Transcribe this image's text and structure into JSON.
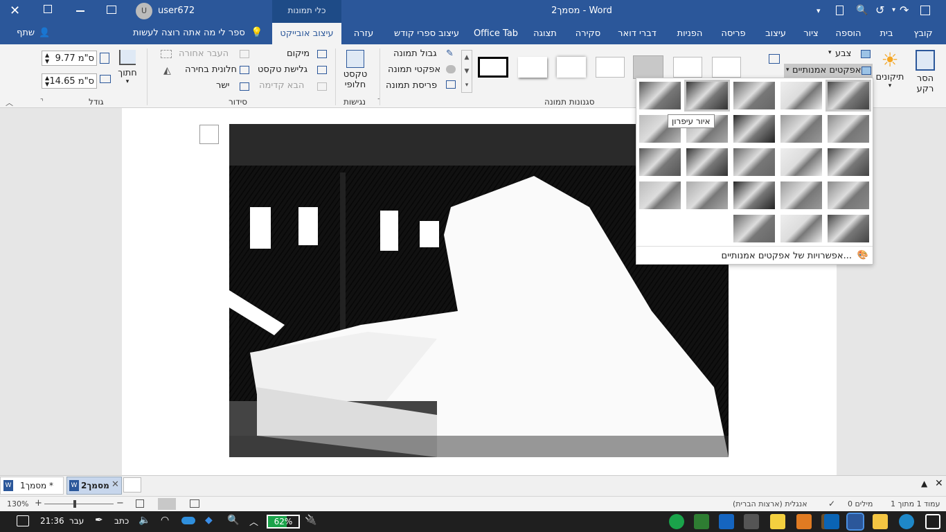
{
  "titlebar": {
    "title": "מסמך2  -  Word",
    "context_label": "כלי תמונות",
    "user_name": "user672",
    "avatar_initial": "U"
  },
  "tabs": [
    {
      "label": "קובץ"
    },
    {
      "label": "בית"
    },
    {
      "label": "הוספה"
    },
    {
      "label": "ציור"
    },
    {
      "label": "עיצוב"
    },
    {
      "label": "פריסה"
    },
    {
      "label": "הפניות"
    },
    {
      "label": "דברי דואר"
    },
    {
      "label": "סקירה"
    },
    {
      "label": "תצוגה"
    },
    {
      "label": "Office Tab"
    },
    {
      "label": "עיצוב ספרי קודש"
    },
    {
      "label": "עזרה"
    },
    {
      "label": "עיצוב אובייקט"
    }
  ],
  "tellme": {
    "placeholder": "ספר לי מה אתה רוצה לעשות"
  },
  "share": {
    "label": "שתף"
  },
  "ribbon": {
    "remove_bg": "הסר\nרקע",
    "corrections": "תיקונים",
    "color": "צבע",
    "artistic_effects": "אפקטים אמנותיים",
    "picture_border": "גבול תמונה",
    "picture_effects": "אפקטי תמונה",
    "picture_layout": "פריסת תמונה",
    "alt_text": "טקסט\nחלופי",
    "position": "מיקום",
    "wrap_text": "גלישת טקסט",
    "align": "ישר",
    "bring_forward": "העבר אחורה",
    "selection_pane": "חלונית בחירה",
    "send_backward": "הבא קדימה",
    "crop": "חתוך",
    "height": "9.77 ס\"מ",
    "width": "14.65 ס\"מ",
    "group_styles": "סגנונות תמונה",
    "group_accessibility": "נגישות",
    "group_arrange": "סידור",
    "group_size": "גודל"
  },
  "gallery": {
    "tooltip": "איור עיפרון",
    "options_link": "אפשרויות של אפקטים אמנותיים..."
  },
  "doctabs": [
    {
      "label": "מסמך1 *"
    },
    {
      "label": "מסמך2"
    }
  ],
  "status": {
    "page": "עמוד 1 מתוך 1",
    "words": "0 מילים",
    "language": "אנגלית (ארצות הברית)",
    "zoom": "130%"
  },
  "taskbar": {
    "time": "21:36",
    "lang": "עבר",
    "battery": "62%",
    "keyboard": "כתב"
  },
  "colors": {
    "accent": "#2b579a",
    "taskbar": "#1f1f1f"
  }
}
